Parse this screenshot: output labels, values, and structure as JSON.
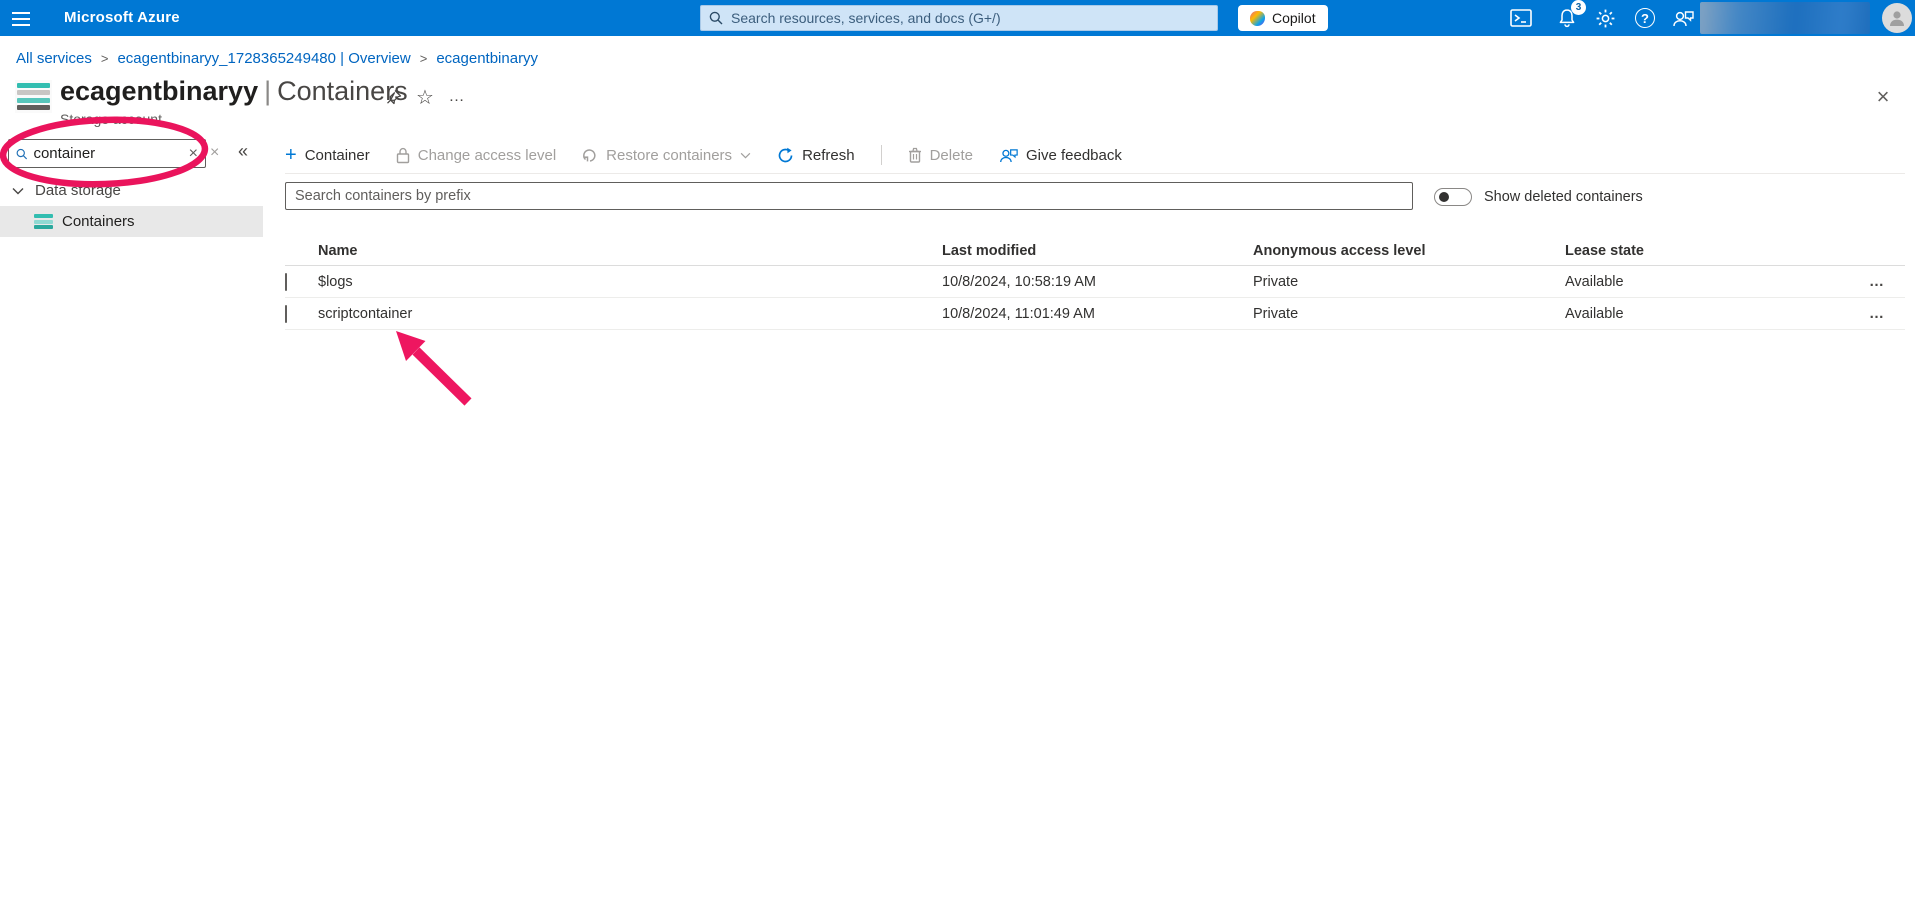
{
  "topbar": {
    "product": "Microsoft Azure",
    "search_placeholder": "Search resources, services, and docs (G+/)",
    "copilot_label": "Copilot",
    "notification_count": "3"
  },
  "breadcrumb": {
    "separator": ">",
    "items": [
      {
        "label": "All services"
      },
      {
        "label": "ecagentbinaryy_1728365249480 | Overview"
      },
      {
        "label": "ecagentbinaryy"
      }
    ]
  },
  "page_header": {
    "resource_name": "ecagentbinaryy",
    "divider": "|",
    "section": "Containers",
    "resource_type": "Storage account"
  },
  "sidebar": {
    "search_value": "container",
    "section_label": "Data storage",
    "active_item_label": "Containers"
  },
  "toolbar": {
    "items": [
      {
        "label": "Container",
        "enabled": true
      },
      {
        "label": "Change access level",
        "enabled": false
      },
      {
        "label": "Restore containers",
        "enabled": false
      },
      {
        "label": "Refresh",
        "enabled": true
      },
      {
        "label": "Delete",
        "enabled": false
      },
      {
        "label": "Give feedback",
        "enabled": true
      }
    ]
  },
  "filter_bar": {
    "search_placeholder": "Search containers by prefix",
    "toggle_label": "Show deleted containers",
    "toggle_on": false
  },
  "table": {
    "columns": {
      "name": "Name",
      "last_modified": "Last modified",
      "access": "Anonymous access level",
      "lease": "Lease state"
    },
    "rows": [
      {
        "name": "$logs",
        "last_modified": "10/8/2024, 10:58:19 AM",
        "access": "Private",
        "lease": "Available"
      },
      {
        "name": "scriptcontainer",
        "last_modified": "10/8/2024, 11:01:49 AM",
        "access": "Private",
        "lease": "Available"
      }
    ]
  },
  "glyphs": {
    "close": "×",
    "collapse": "«",
    "more": "…",
    "plus": "+",
    "help": "?",
    "star": "☆"
  },
  "colors": {
    "azure_blue": "#0078d4",
    "link_blue": "#0065c0",
    "teal": "#32bdb0",
    "disabled_gray": "#a19f9d",
    "annotation_pink": "#ea145c"
  }
}
